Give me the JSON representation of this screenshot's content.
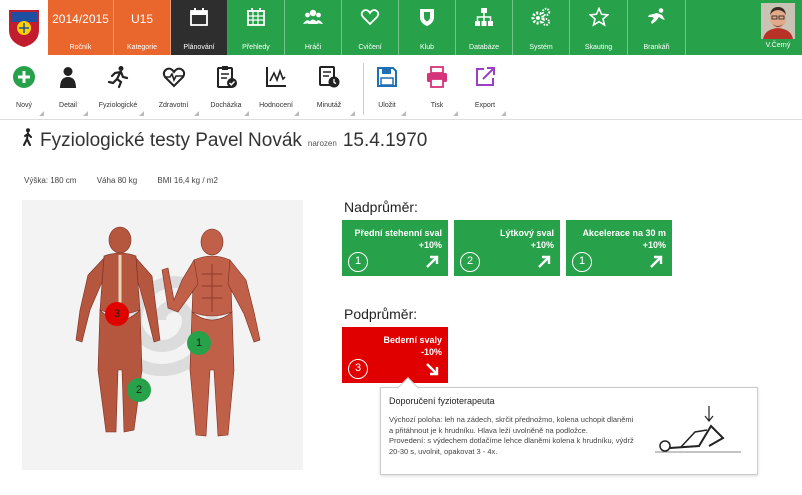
{
  "topnav": {
    "season": {
      "value": "2014/2015",
      "label": "Ročník"
    },
    "category": {
      "value": "U15",
      "label": "Kategorie"
    },
    "items": [
      {
        "label": "Plánování",
        "icon": "calendar-icon"
      },
      {
        "label": "Přehledy",
        "icon": "grid-calendar-icon"
      },
      {
        "label": "Hráči",
        "icon": "users-icon"
      },
      {
        "label": "Cvičení",
        "icon": "heart-icon"
      },
      {
        "label": "Klub",
        "icon": "shield-icon"
      },
      {
        "label": "Databáze",
        "icon": "sitemap-icon"
      },
      {
        "label": "Systém",
        "icon": "gears-icon"
      },
      {
        "label": "Skauting",
        "icon": "star-icon"
      },
      {
        "label": "Brankáři",
        "icon": "goalkeeper-icon"
      }
    ],
    "user": "V.Černý"
  },
  "toolbar": {
    "items": [
      {
        "label": "Nový",
        "icon": "plus-icon"
      },
      {
        "label": "Detail",
        "icon": "person-icon"
      },
      {
        "label": "Fyziologické",
        "icon": "runner-icon"
      },
      {
        "label": "Zdravotní",
        "icon": "heartbeat-icon"
      },
      {
        "label": "Docházka",
        "icon": "clipboard-check-icon"
      },
      {
        "label": "Hodnocení",
        "icon": "line-chart-icon"
      },
      {
        "label": "Minutáž",
        "icon": "clock-doc-icon"
      }
    ],
    "actions": [
      {
        "label": "Uložit",
        "icon": "save-icon"
      },
      {
        "label": "Tisk",
        "icon": "print-icon"
      },
      {
        "label": "Export",
        "icon": "export-icon"
      }
    ]
  },
  "page": {
    "title": "Fyziologické testy Pavel Novák",
    "born_label": "narozen",
    "born_date": "15.4.1970",
    "height": "Výška: 180 cm",
    "weight": "Váha 80 kg",
    "bmi": "BMI 16,4 kg / m2"
  },
  "above": {
    "heading": "Nadprůměr:",
    "cards": [
      {
        "name": "Přední stehenní sval",
        "pct": "+10%",
        "num": "1"
      },
      {
        "name": "Lýtkový sval",
        "pct": "+10%",
        "num": "2"
      },
      {
        "name": "Akcelerace na 30 m",
        "pct": "+10%",
        "num": "1"
      }
    ]
  },
  "below": {
    "heading": "Podprůměr:",
    "cards": [
      {
        "name": "Bederní svaly",
        "pct": "-10%",
        "num": "3"
      }
    ]
  },
  "markers": [
    "3",
    "1",
    "2"
  ],
  "popup": {
    "title": "Doporučení fyzioterapeuta",
    "text1": "Výchozí poloha: leh na zádech, skrčit přednožmo, kolena uchopit dlaněmi a přitáhnout je k hrudníku. Hlava leží uvolněně na podložce.",
    "text2": "Provedení: s výdechem dotlačíme lehce dlaněmi kolena k hrudníku, výdrž 20-30 s, uvolnit, opakovat 3 - 4x."
  },
  "colors": {
    "green": "#27a14a",
    "orange": "#e9662d",
    "dark": "#2e2e2e",
    "red": "#e00000",
    "purple": "#9b3fc6",
    "pink": "#d6347a",
    "blue": "#1f6fb5"
  }
}
